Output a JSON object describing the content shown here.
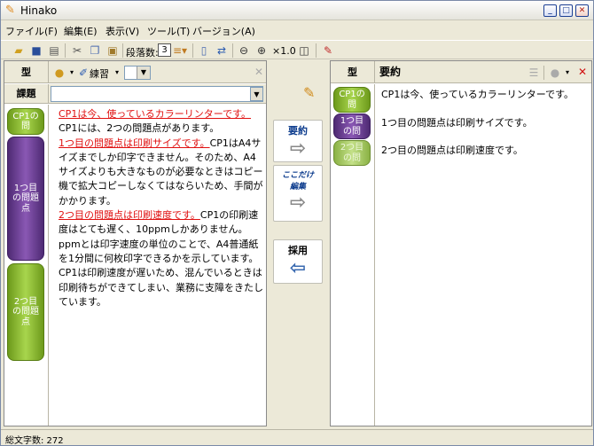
{
  "window": {
    "title": "Hinako"
  },
  "menu": [
    "ファイル(F)",
    "編集(E)",
    "表示(V)",
    "ツール(T)",
    "バージョン(A)"
  ],
  "toolbar": {
    "paragraph_label": "段落数:",
    "paragraph_value": "3",
    "zoom_label": "×1.0"
  },
  "left": {
    "kata_label": "型",
    "practice_label": "練習",
    "kadai_label": "課題",
    "kadai_value": "",
    "tags": [
      "CP1の問",
      "1つ目の問題点",
      "2つ目の問題点"
    ],
    "paragraphs": [
      {
        "highlight": "CP1は今、使っているカラーリンターです。",
        "rest": "CP1には、2つの問題点があります。"
      },
      {
        "highlight": "1つ目の問題点は印刷サイズです。",
        "rest": "CP1はA4サイズまでしか印字できません。そのため、A4サイズよりも大きなものが必要なときはコピー機で拡大コピーしなくてはならいため、手間がかかります。"
      },
      {
        "highlight": "2つ目の問題点は印刷速度です。",
        "rest": "CP1の印刷速度はとても遅く、10ppmしかありません。ppmとは印字速度の単位のことで、A4普通紙を1分間に何枚印字できるかを示しています。CP1は印刷速度が遅いため、混んでいるときは印刷待ちができてしまい、業務に支障をきたしています。"
      }
    ]
  },
  "middle": {
    "summarize_label": "要約",
    "edit_only_label_1": "ここだけ",
    "edit_only_label_2": "編集",
    "adopt_label": "採用"
  },
  "right": {
    "kata_label": "型",
    "summary_label": "要約",
    "tags": [
      "CP1の問",
      "1つ目の問",
      "2つ目の問"
    ],
    "lines": [
      "CP1は今、使っているカラーリンターです。",
      "1つ目の問題点は印刷サイズです。",
      "2つ目の問題点は印刷速度です。"
    ]
  },
  "status": {
    "char_count": "総文字数: 272"
  },
  "colors": {
    "highlight": "#e01010",
    "green_tag": "#8cbf2f",
    "purple_tag": "#6a3e94"
  }
}
